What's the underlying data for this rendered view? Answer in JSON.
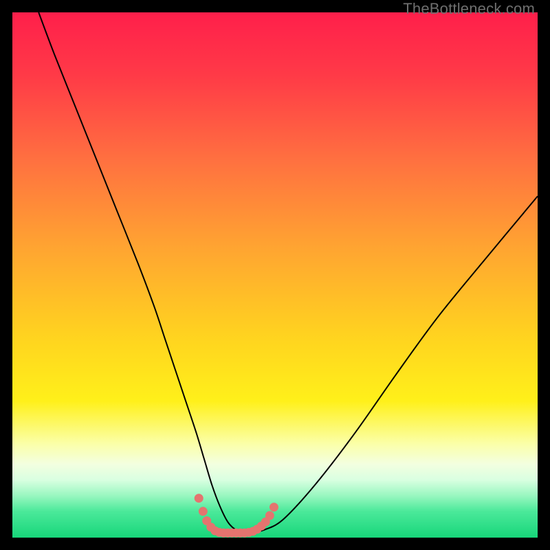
{
  "watermark": "TheBottleneck.com",
  "colors": {
    "black": "#000000",
    "curve_stroke": "#000000",
    "marker_fill": "#e4746f",
    "marker_stroke": "#e4746f",
    "gradient_stops": [
      {
        "offset": "0%",
        "color": "#ff1f4b"
      },
      {
        "offset": "12%",
        "color": "#ff3a47"
      },
      {
        "offset": "28%",
        "color": "#ff7040"
      },
      {
        "offset": "45%",
        "color": "#ffa531"
      },
      {
        "offset": "62%",
        "color": "#ffd41f"
      },
      {
        "offset": "74%",
        "color": "#fff01a"
      },
      {
        "offset": "82%",
        "color": "#fbffa6"
      },
      {
        "offset": "86%",
        "color": "#f3ffe0"
      },
      {
        "offset": "89%",
        "color": "#d9ffe1"
      },
      {
        "offset": "92%",
        "color": "#99f7c0"
      },
      {
        "offset": "95%",
        "color": "#4be99a"
      },
      {
        "offset": "100%",
        "color": "#17d67a"
      }
    ]
  },
  "chart_data": {
    "type": "line",
    "title": "",
    "xlabel": "",
    "ylabel": "",
    "xlim": [
      0,
      100
    ],
    "ylim": [
      0,
      100
    ],
    "grid": false,
    "series": [
      {
        "name": "bottleneck-curve",
        "x": [
          5,
          8,
          12,
          16,
          20,
          24,
          27,
          29,
          31,
          33,
          35,
          36.5,
          38,
          39.5,
          41,
          42.5,
          44,
          46,
          48,
          51,
          55,
          60,
          66,
          73,
          81,
          90,
          100
        ],
        "y": [
          100,
          92,
          82,
          72,
          62,
          52,
          44,
          38,
          32,
          26,
          20,
          15,
          10,
          6,
          3,
          1.5,
          1,
          1,
          1.5,
          3,
          7,
          13,
          21,
          31,
          42,
          53,
          65
        ]
      }
    ],
    "markers": {
      "name": "bottom-cluster",
      "x": [
        35.5,
        36.3,
        37.0,
        37.8,
        38.6,
        39.4,
        40.2,
        41.0,
        41.8,
        42.6,
        43.4,
        44.2,
        45.0,
        45.8,
        46.6,
        47.4,
        48.2,
        49.0,
        49.8
      ],
      "y": [
        7.5,
        5.0,
        3.2,
        2.0,
        1.3,
        1.0,
        0.9,
        0.9,
        0.9,
        0.9,
        0.9,
        0.9,
        1.0,
        1.2,
        1.6,
        2.2,
        3.0,
        4.2,
        5.8
      ],
      "r": 6
    }
  }
}
